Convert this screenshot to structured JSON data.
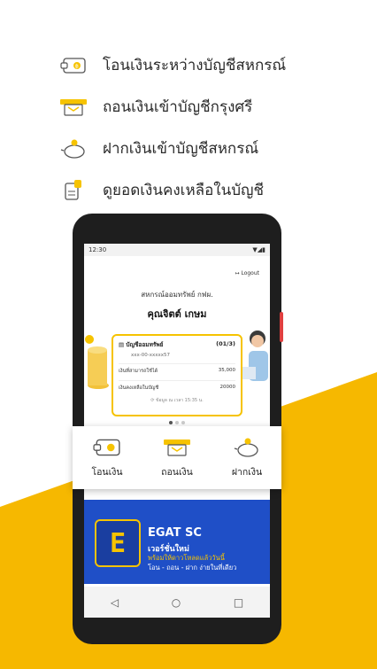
{
  "features": [
    {
      "icon": "wallet-transfer-icon",
      "label": "โอนเงินระหว่างบัญชีสหกรณ์"
    },
    {
      "icon": "cash-withdraw-icon",
      "label": "ถอนเงินเข้าบัญชีกรุงศรี"
    },
    {
      "icon": "piggy-bank-icon",
      "label": "ฝากเงินเข้าบัญชีสหกรณ์"
    },
    {
      "icon": "balance-document-icon",
      "label": "ดูยอดเงินคงเหลือในบัญชี"
    }
  ],
  "phone": {
    "status_time": "12:30",
    "logout": "Logout",
    "coop_name": "สหกรณ์ออมทรัพย์ กฟผ.",
    "user_name": "คุณจิตต์ เกษม",
    "card": {
      "title": "บัญชีออมทรัพย์",
      "page": "(01/3)",
      "account": "xxx-00-xxxxx57",
      "row1_label": "เงินที่สามารถใช้ได้",
      "row1_value": "35,000",
      "row2_label": "เงินคงเหลือในบัญชี",
      "row2_value": "20000",
      "time_label": "ข้อมูล ณ เวลา 15:35 น."
    }
  },
  "actions": [
    {
      "icon": "wallet-transfer-icon",
      "label": "โอนเงิน"
    },
    {
      "icon": "cash-withdraw-icon",
      "label": "ถอนเงิน"
    },
    {
      "icon": "piggy-bank-icon",
      "label": "ฝากเงิน"
    }
  ],
  "banner": {
    "logo_letter": "E",
    "title": "EGAT SC",
    "subtitle": "เวอร์ชั่นใหม่",
    "line2": "พร้อมให้ดาวโหลดแล้ววันนี้",
    "line3": "โอน - ถอน - ฝาก  ง่ายในที่เดียว"
  },
  "navbar": {
    "back": "◁",
    "home": "○",
    "recent": "□"
  },
  "colors": {
    "accent": "#f6b800",
    "banner": "#1f4fc7"
  }
}
